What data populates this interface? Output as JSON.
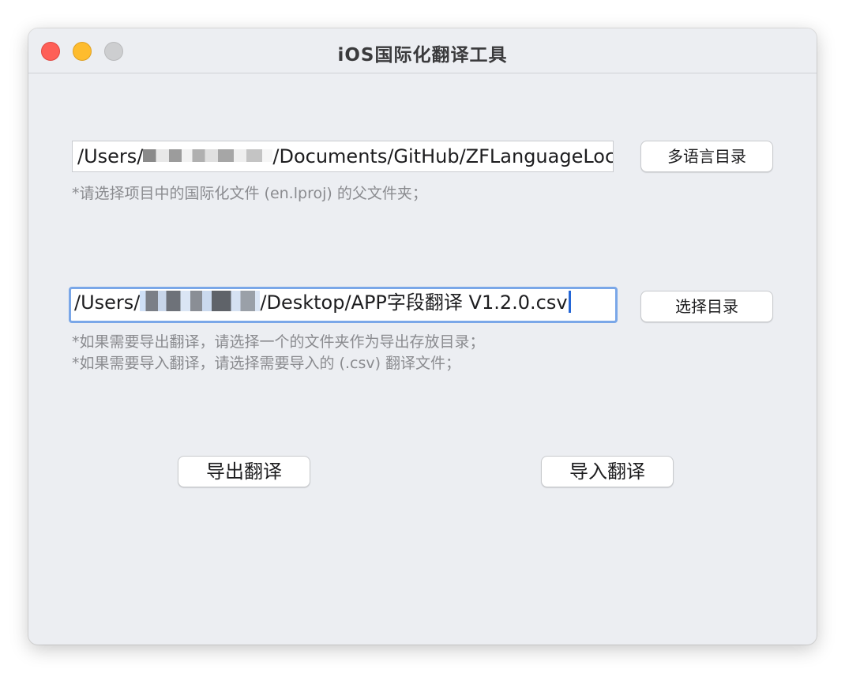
{
  "window": {
    "title": "iOS国际化翻译工具"
  },
  "language_dir": {
    "path_prefix": "/Users/",
    "path_suffix": "/Documents/GitHub/ZFLanguageLoc",
    "button_label": "多语言目录",
    "hint": "*请选择项目中的国际化文件 (en.lproj) 的父文件夹；"
  },
  "output_dir": {
    "path_prefix": "/Users/",
    "path_suffix": "/Desktop/APP字段翻译 V1.2.0.csv",
    "button_label": "选择目录",
    "hints": [
      "*如果需要导出翻译，请选择一个的文件夹作为导出存放目录；",
      "*如果需要导入翻译，请选择需要导入的 (.csv) 翻译文件；"
    ]
  },
  "actions": {
    "export_label": "导出翻译",
    "import_label": "导入翻译"
  },
  "colors": {
    "window_bg": "#eceef2",
    "close": "#fe5f57",
    "minimize": "#febc2e",
    "zoom": "#cdced0",
    "focus_ring": "#7aa7e8",
    "hint_text": "#8a8b8f"
  },
  "icons": [
    "close-icon",
    "minimize-icon",
    "zoom-icon"
  ]
}
